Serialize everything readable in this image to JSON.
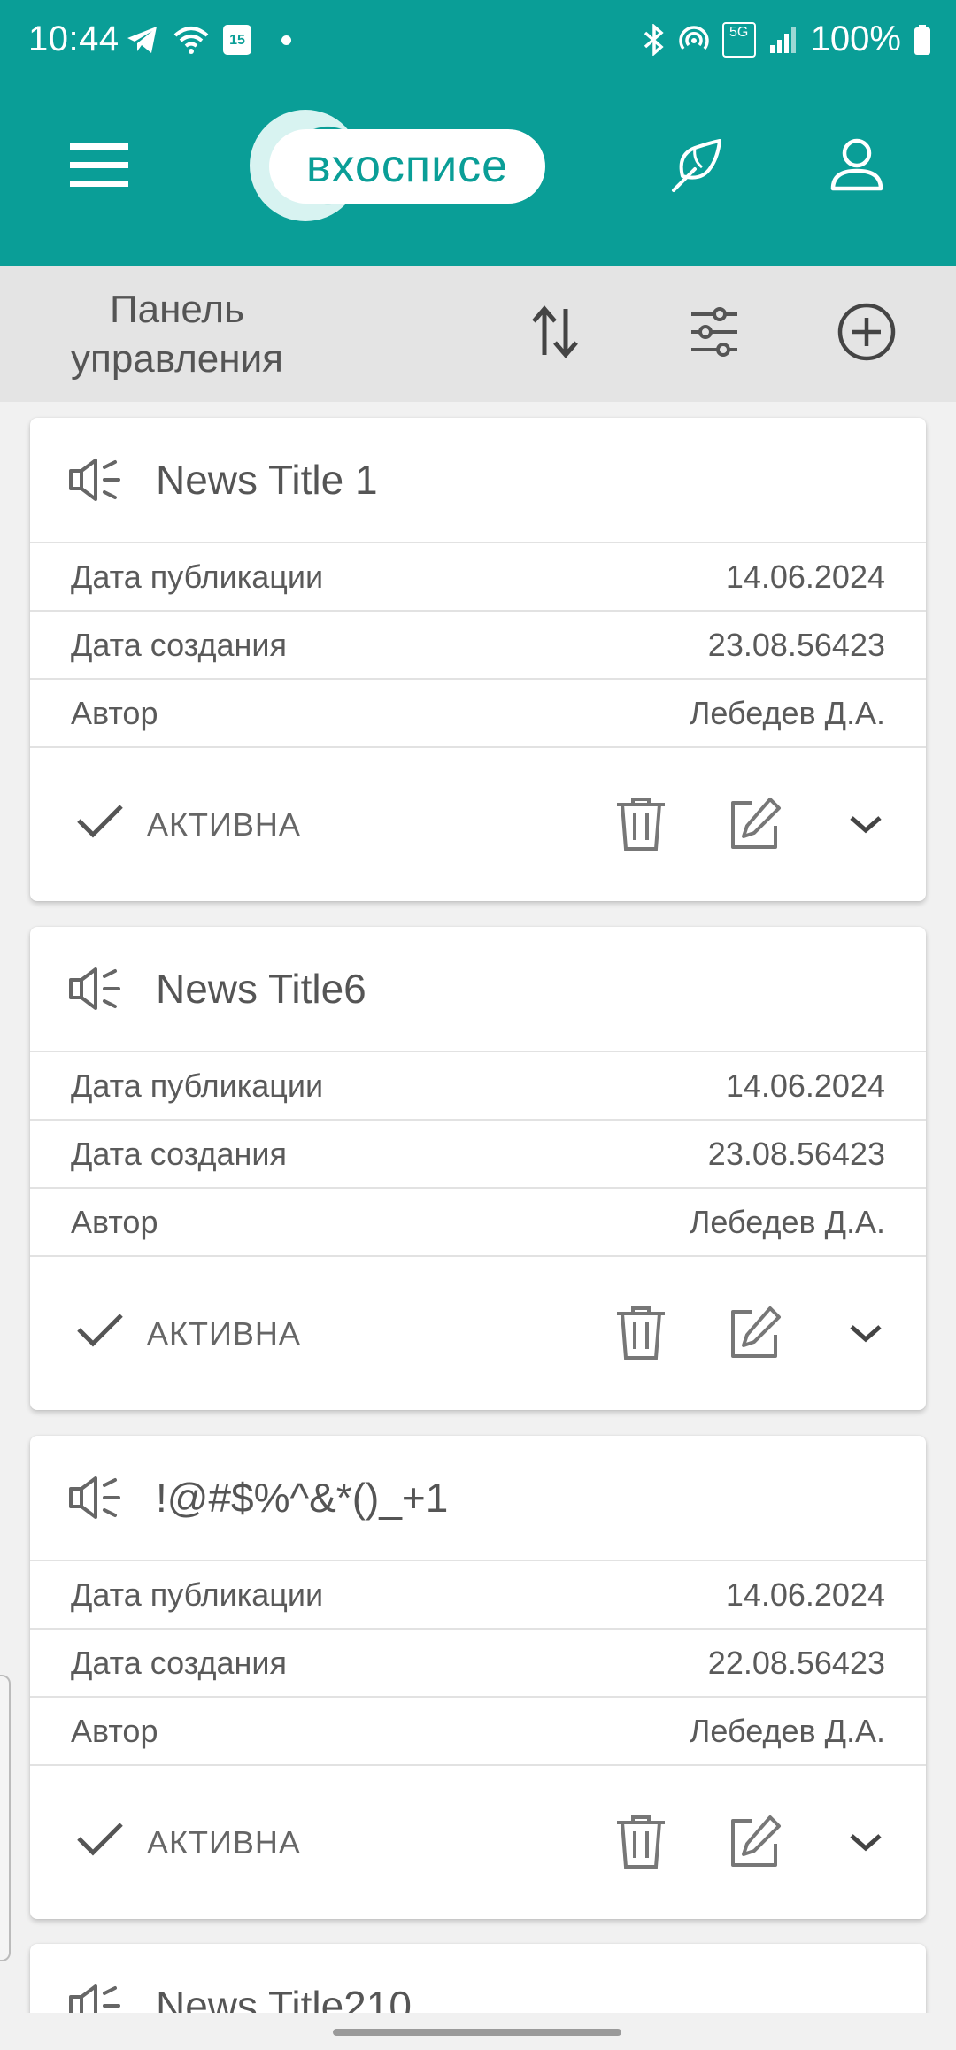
{
  "status_bar": {
    "time": "10:44",
    "calendar_day": "15",
    "network": "5G",
    "battery": "100%"
  },
  "header": {
    "logo_text": "вхосписе",
    "colors": {
      "primary": "#0a9e97",
      "on_primary": "#ffffff"
    }
  },
  "toolbar": {
    "title": "Панель управления",
    "icons": [
      "sort-icon",
      "filter-icon",
      "add-circle-icon"
    ]
  },
  "labels": {
    "publication_date": "Дата публикации",
    "creation_date": "Дата создания",
    "author": "Автор"
  },
  "cards": [
    {
      "title": "News Title 1",
      "publication_date": "14.06.2024",
      "creation_date": "23.08.56423",
      "author": "Лебедев Д.А.",
      "status": "АКТИВНА"
    },
    {
      "title": "News Title6",
      "publication_date": "14.06.2024",
      "creation_date": "23.08.56423",
      "author": "Лебедев Д.А.",
      "status": "АКТИВНА"
    },
    {
      "title": "!@#$%^&*()_+1",
      "publication_date": "14.06.2024",
      "creation_date": "22.08.56423",
      "author": "Лебедев Д.А.",
      "status": "АКТИВНА"
    },
    {
      "title": "News Title210"
    }
  ]
}
